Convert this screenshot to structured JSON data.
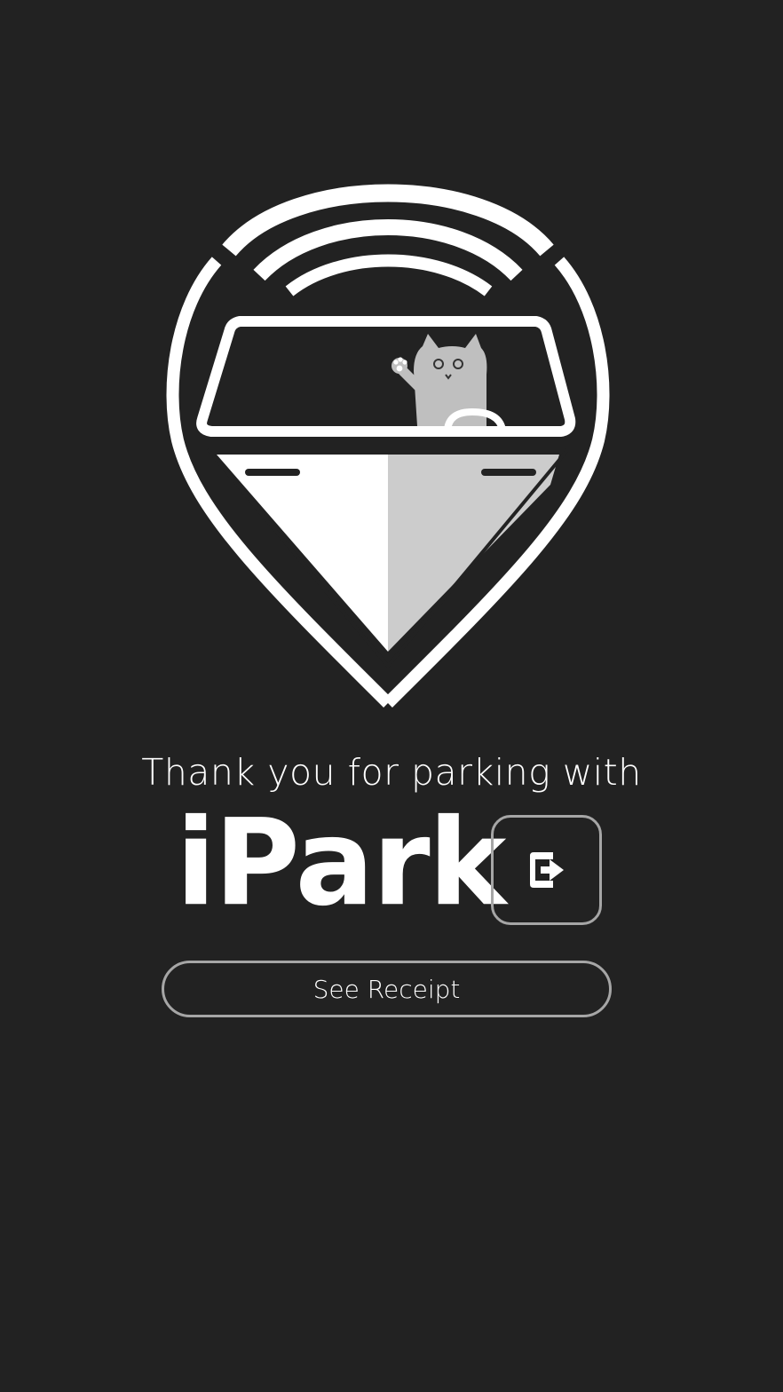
{
  "logo": {
    "icon": "ipark-cat-car-pin-logo",
    "colors": {
      "background": "#222222",
      "primary": "#ffffff",
      "shade": "#cccccc",
      "cat": "#bfbfbf"
    }
  },
  "message": {
    "thanks_text": "Thank you for parking with",
    "brand_name": "iPark"
  },
  "actions": {
    "logout_icon": "logout-icon",
    "receipt_label": "See Receipt"
  },
  "theme": {
    "background": "#222222",
    "text": "#ffffff",
    "border": "#a6a6a6"
  }
}
